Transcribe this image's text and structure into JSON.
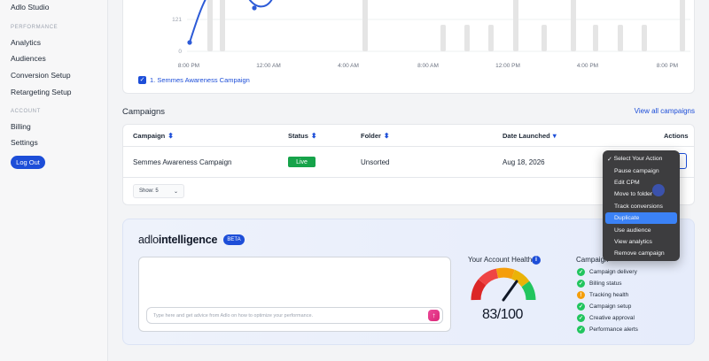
{
  "sidebar": {
    "studio_label": "Adlo Studio",
    "performance_heading": "PERFORMANCE",
    "performance_items": [
      "Analytics",
      "Audiences",
      "Conversion Setup",
      "Retargeting Setup"
    ],
    "account_heading": "ACCOUNT",
    "account_items": [
      "Billing",
      "Settings"
    ],
    "logout_label": "Log Out"
  },
  "chart": {
    "y_ticks": [
      "121",
      "0"
    ],
    "x_ticks": [
      "8:00 PM",
      "12:00 AM",
      "4:00 AM",
      "8:00 AM",
      "12:00 PM",
      "4:00 PM",
      "8:00 PM"
    ],
    "legend_label": "1. Semmes Awareness Campaign",
    "series_color": "#2d5bd7"
  },
  "campaigns": {
    "title": "Campaigns",
    "view_all": "View all campaigns",
    "columns": {
      "campaign": "Campaign",
      "status": "Status",
      "folder": "Folder",
      "date": "Date Launched",
      "actions": "Actions"
    },
    "row": {
      "campaign": "Semmes Awareness Campaign",
      "status": "Live",
      "folder": "Unsorted",
      "date": "Aug 18, 2026"
    },
    "show_label": "Show: 5"
  },
  "actions_menu": {
    "header": "Select Your Action",
    "items": [
      "Pause campaign",
      "Edit CPM",
      "Move to folder",
      "Track conversions",
      "Duplicate",
      "Use audience",
      "View analytics",
      "Remove campaign"
    ],
    "active_index": 4
  },
  "intelligence": {
    "brand_light": "adlo",
    "brand_bold": "intelligence",
    "beta": "BETA",
    "input_placeholder": "Type here and get advice from Adlo on how to optimize your performance.",
    "health_title": "Your Account Health",
    "score": "83/100",
    "score_value": 83,
    "checks_title": "Campaign",
    "checks": [
      {
        "label": "Campaign delivery",
        "status": "ok"
      },
      {
        "label": "Billing status",
        "status": "ok"
      },
      {
        "label": "Tracking health",
        "status": "warn"
      },
      {
        "label": "Campaign setup",
        "status": "ok"
      },
      {
        "label": "Creative approval",
        "status": "ok"
      },
      {
        "label": "Performance alerts",
        "status": "ok"
      }
    ]
  }
}
